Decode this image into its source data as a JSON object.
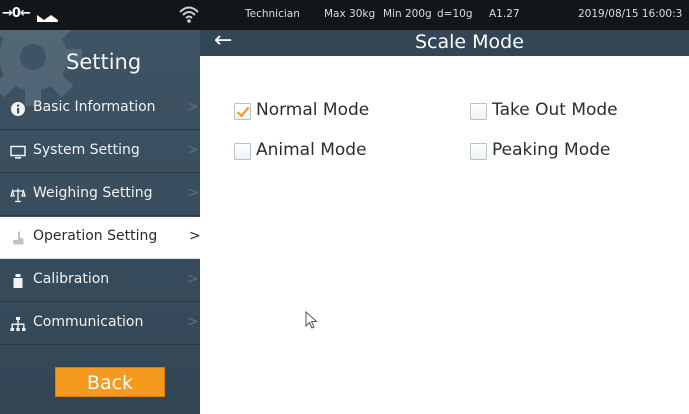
{
  "status_bar": {
    "zero_indicator": "→0←",
    "user": "Technician",
    "capacity": "Max 30kg",
    "minimum": "Min 200g",
    "division": "d=10g",
    "version": "A1.27",
    "datetime": "2019/08/15 16:00:3"
  },
  "sidebar": {
    "title": "Setting",
    "items": [
      {
        "label": "Basic Information",
        "icon": "info-icon",
        "active": false
      },
      {
        "label": "System Setting",
        "icon": "monitor-icon",
        "active": false
      },
      {
        "label": "Weighing Setting",
        "icon": "balance-scale-icon",
        "active": false
      },
      {
        "label": "Operation Setting",
        "icon": "hand-pointer-icon",
        "active": true
      },
      {
        "label": "Calibration",
        "icon": "weight-icon",
        "active": false
      },
      {
        "label": "Communication",
        "icon": "network-icon",
        "active": false
      }
    ],
    "arrow": ">",
    "back_label": "Back"
  },
  "header": {
    "back_arrow": "←",
    "title": "Scale Mode"
  },
  "options": [
    {
      "label": "Normal Mode",
      "checked": true
    },
    {
      "label": "Take Out Mode",
      "checked": false
    },
    {
      "label": "Animal Mode",
      "checked": false
    },
    {
      "label": "Peaking Mode",
      "checked": false
    }
  ],
  "colors": {
    "sidebar_bg": "#3e5363",
    "header_bg": "#324656",
    "status_bg": "#121619",
    "accent_orange": "#f59a1e",
    "check_orange": "#f59a1e"
  }
}
